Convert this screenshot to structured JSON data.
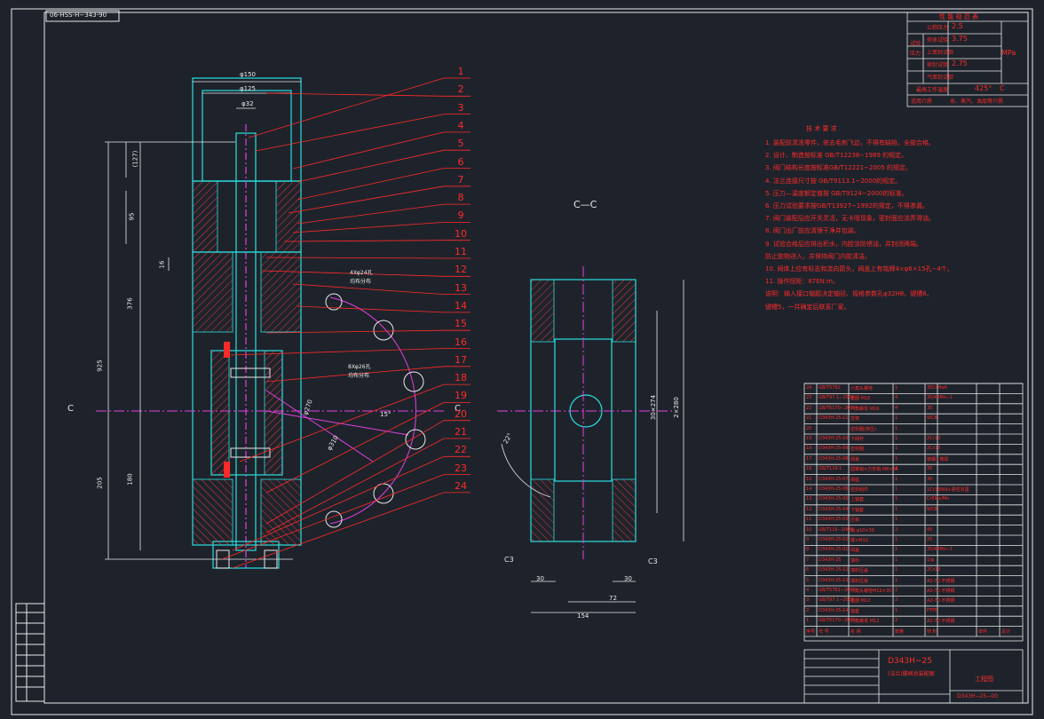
{
  "drawing_code_top": "06-HSS-H−343-90",
  "section_label": "C—C",
  "section_marker_left": "C",
  "section_marker_right": "C",
  "balloon_numbers": [
    "1",
    "2",
    "3",
    "4",
    "5",
    "6",
    "7",
    "8",
    "9",
    "10",
    "11",
    "12",
    "13",
    "14",
    "15",
    "16",
    "17",
    "18",
    "19",
    "20",
    "21",
    "22",
    "23",
    "24"
  ],
  "dimensions": {
    "d150": "φ150",
    "d125": "φ125",
    "d32": "φ32",
    "v_127": "(127)",
    "v_95": "95",
    "v_16": "16",
    "v_376": "376",
    "v_925": "925",
    "v_180": "180",
    "v_205": "205",
    "d270": "φ270",
    "d310": "φ310",
    "ang15": "15°",
    "ang22": "22°",
    "v_30x274": "30×274",
    "v_2x280": "2×280",
    "c3_left": "C3",
    "c3_right": "C3",
    "h_30_left": "30",
    "h_30_right": "30",
    "h_72": "72",
    "h_154": "154",
    "note_4x": "4Xφ24孔",
    "note_4x_b": "均布分布",
    "note_8x": "8Xφ26孔",
    "note_8x_b": "均布分布"
  },
  "perf_table": {
    "title": "性 能 规 范 表",
    "side_label": "试验压力",
    "rows": [
      {
        "label": "公称压力",
        "value": "2.5"
      },
      {
        "label": "壳体试验",
        "value": "3.75"
      },
      {
        "label": "上密封试验",
        "value": ""
      },
      {
        "label": "密封试验",
        "value": "2.75"
      },
      {
        "label": "气密封试验",
        "value": ""
      }
    ],
    "unit": "MPa",
    "temp_label": "最高工作温度",
    "temp_value": "425°",
    "temp_unit": "C",
    "medium_label": "适用介质",
    "medium_value": "水、蒸汽、油品等介质"
  },
  "tech_req": {
    "title": "技 术 要 求",
    "items": [
      "1. 装配前清洗零件，修去毛刺飞边，不得有缺陷，全部合格。",
      "2. 设计、制造按标准 GB/T12238−1989 的规定。",
      "3. 阀门结构长度按标准GB/T12221−2005 的规定。",
      "4. 法兰连接尺寸按 GB/T9113.1−2000的规定。",
      "5. 压力—温度额定值按 GB/T9124−2000的标准。",
      "6. 压力试验要求按GB/T13927−1992的规定，不得渗漏。",
      "7. 阀门装配后应开关灵活，无卡阻现象，密封面应涂弄滑油。",
      "8. 阀门出厂前应清理干净并包装。",
      "9. 试验合格后应排出积水，内腔涂防锈油，并封闭两端。",
      "   防止脏物进入，并保持阀门内腔清洁。",
      "10. 阀体上应有标志和流向箭头，阀盖上有铭牌4×φ6×15孔−4个。",
      "11. 操作扭矩：87EN.m。",
      "说明：输入接口轴题决定轴径、规格参数孔φ32H8、键槽6、",
      "   键槽5，一并确定后联系厂家。"
    ]
  },
  "bom": {
    "rows": [
      [
        "24",
        "GB/T5782",
        "六角头螺栓",
        "1",
        "35CrMoA",
        "",
        ""
      ],
      [
        "23",
        "GB/T97.1−2002",
        "垫圈 M16",
        "4",
        "35/40Mn−1",
        "",
        ""
      ],
      [
        "22",
        "GB/T6170−2000",
        "六角螺母 M16",
        "4",
        "35",
        "",
        ""
      ],
      [
        "21",
        "D343H-25-11",
        "支架",
        "1",
        "WCB",
        "",
        ""
      ],
      [
        "20",
        "",
        "密封圈(挤压)",
        "1",
        "",
        "",
        ""
      ],
      [
        "19",
        "D343H-25-10",
        "下阀杆",
        "1",
        "2Cr13",
        "",
        ""
      ],
      [
        "18",
        "D343H-25-09",
        "密封圈",
        "1",
        "2Cr13",
        "",
        ""
      ],
      [
        "17",
        "D343H-25-08",
        "阀板",
        "1",
        "铸钢+堆焊",
        "",
        ""
      ],
      [
        "16",
        "GB/T119.1",
        "圆锥销×方形销 M8×35",
        "2",
        "35",
        "",
        ""
      ],
      [
        "15",
        "D343H-25-07",
        "阀座",
        "1",
        "30",
        "",
        ""
      ],
      [
        "14",
        "D343H-25-06",
        "密封组件",
        "1",
        "1Cr18Ni9+柔性石墨",
        "",
        ""
      ],
      [
        "13",
        "D343H-25-05",
        "上轴套",
        "1",
        "Cr5Mo/Mn",
        "",
        ""
      ],
      [
        "12",
        "D343H-25-04",
        "下轴套",
        "1",
        "WCB",
        "",
        ""
      ],
      [
        "11",
        "D343H-25-03",
        "压板",
        "1",
        "",
        "",
        ""
      ],
      [
        "10",
        "GB/T116−2000",
        "销 φ10×30",
        "2",
        "45",
        "",
        ""
      ],
      [
        "9",
        "D343H-25-02",
        "键×M10",
        "1",
        "25",
        "",
        ""
      ],
      [
        "8",
        "D343H-25-01",
        "阀盖",
        "1",
        "35/40Mn−1",
        "",
        ""
      ],
      [
        "7",
        "D343H-25",
        "填料",
        "1",
        "1/φ",
        "",
        ""
      ],
      [
        "6",
        "D343H-25-12",
        "填料压盖",
        "1",
        "2Cr13",
        "",
        ""
      ],
      [
        "5",
        "D343H-25-13",
        "填料压板",
        "1",
        "A2-70 不锈钢",
        "",
        ""
      ],
      [
        "4",
        "GB/T5781−2000",
        "六角头螺栓M12×35",
        "2",
        "A2-70 不锈钢",
        "",
        ""
      ],
      [
        "3",
        "GB/T97.1−2002",
        "垫圈 M12",
        "2",
        "A2-70 不锈钢",
        "",
        ""
      ],
      [
        "2",
        "D343H-25-14",
        "轴套",
        "1",
        "PTFE",
        "",
        ""
      ],
      [
        "1",
        "GB/T6170−2000",
        "六角螺母 M12",
        "2",
        "A2-70 不锈钢",
        "",
        ""
      ]
    ],
    "header": [
      "序号",
      "代 号",
      "名 称",
      "数量",
      "材 料",
      "单件",
      "总计"
    ]
  },
  "title_block": {
    "model": "D343H−25",
    "name": "(法兰)蝶阀总装配图",
    "drawing_no": "D343H−25−00",
    "org": "工程图"
  }
}
